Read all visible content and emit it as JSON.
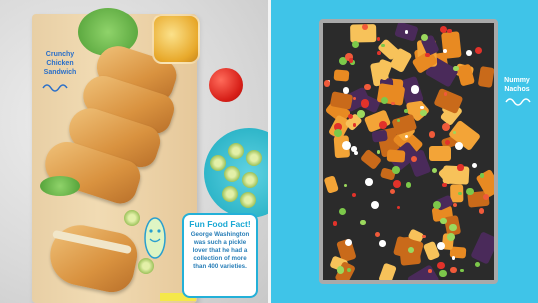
{
  "left_page": {
    "label": "Crunchy Chicken Sandwich",
    "fact": {
      "title": "Fun Food Fact!",
      "body": "George Washington was such a pickle lover that he had a collection of more than 400 varieties."
    }
  },
  "right_page": {
    "label": "Nummy Nachos"
  },
  "colors": {
    "right_background": "#3fc4e8",
    "label_blue": "#2a6fc9",
    "fact_border": "#23b0d8"
  }
}
